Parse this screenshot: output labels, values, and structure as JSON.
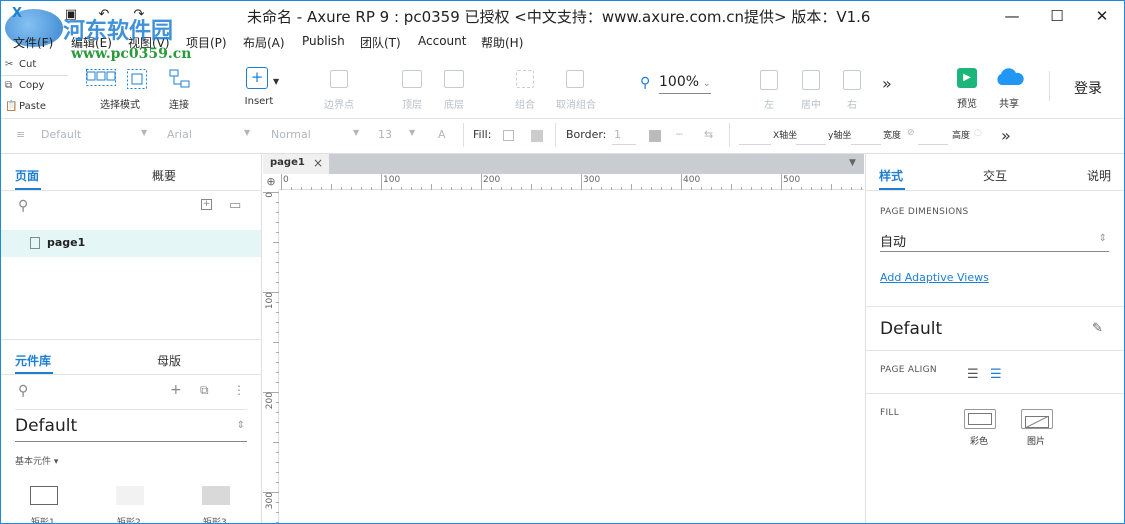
{
  "titlebar": {
    "title": "未命名 - Axure RP 9 : pc0359 已授权    <中文支持：www.axure.com.cn提供> 版本：V1.6",
    "watermark": "河东软件园",
    "watermark_url": "www.pc0359.cn",
    "minimize": "—",
    "maximize": "☐",
    "close": "✕"
  },
  "menu": [
    "文件(F)",
    "编辑(E)",
    "视图(V)",
    "项目(P)",
    "布局(A)",
    "Publish",
    "团队(T)",
    "Account",
    "帮助(H)"
  ],
  "clipboard": {
    "cut": "Cut",
    "copy": "Copy",
    "paste": "Paste"
  },
  "toolbar": {
    "select_mode": "选择模式",
    "connect": "连接",
    "insert": "Insert",
    "boundary_points": "边界点",
    "top_layer": "顶层",
    "bottom_layer": "底层",
    "group": "组合",
    "ungroup": "取消组合",
    "zoom": "100%",
    "align_left": "左",
    "align_center": "居中",
    "align_right": "右",
    "more": "»",
    "preview": "预览",
    "share": "共享",
    "login": "登录"
  },
  "format": {
    "style": "Default",
    "font": "Arial",
    "weight": "Normal",
    "size": "13",
    "font_color": "A",
    "fill": "Fill:",
    "border": "Border:",
    "border_width": "1",
    "x_label": "X轴坐",
    "y_label": "y轴坐",
    "width_label": "宽度",
    "height_label": "高度",
    "more": "»"
  },
  "left": {
    "tabs": [
      "页面",
      "概要"
    ],
    "pages": [
      "page1"
    ],
    "lib_tabs": [
      "元件库",
      "母版"
    ],
    "library": "Default",
    "category": "基本元件 ▾",
    "widgets": [
      "矩形1",
      "矩形2",
      "矩形3"
    ]
  },
  "canvas": {
    "tab": "page1",
    "close": "×",
    "ruler_top": [
      "0",
      "100",
      "200",
      "300",
      "400",
      "500"
    ],
    "ruler_left": [
      "0",
      "100",
      "200",
      "300"
    ]
  },
  "right": {
    "tabs": [
      "样式",
      "交互",
      "说明"
    ],
    "page_dimensions_label": "PAGE DIMENSIONS",
    "page_dimensions_value": "自动",
    "adaptive_link": "Add Adaptive Views",
    "style_name": "Default",
    "page_align_label": "PAGE ALIGN",
    "fill_label": "FILL",
    "fill_color": "彩色",
    "fill_image": "图片"
  },
  "colors": {
    "accent": "#1e7fd1",
    "preview_green": "#1cb57a",
    "share_blue": "#2196f3"
  }
}
